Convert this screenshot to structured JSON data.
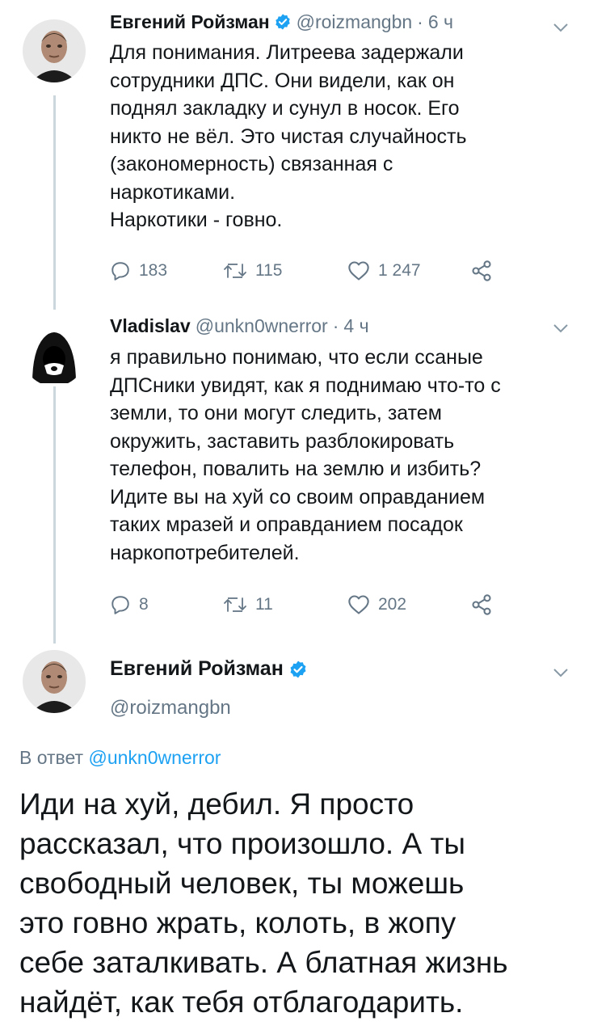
{
  "colors": {
    "text": "#14171a",
    "secondary": "#657786",
    "link": "#1da1f2",
    "verified": "#1da1f2",
    "thread_line": "#ccd6dd"
  },
  "tweet1": {
    "name": "Евгений Ройзман",
    "handle": "@roizmangbn",
    "time": "6 ч",
    "lines": [
      "Для понимания. Литреева задержали",
      "сотрудники ДПС. Они видели, как он",
      "поднял закладку и сунул в носок. Его",
      "никто не вёл. Это чистая случайность",
      "(закономерность) связанная с",
      "наркотиками.",
      "Наркотики - говно."
    ],
    "replies": "183",
    "retweets": "115",
    "likes": "1 247"
  },
  "tweet2": {
    "name": "Vladislav",
    "handle": "@unkn0wnerror",
    "time": "4 ч",
    "lines": [
      "я правильно понимаю, что если ссаные",
      "ДПСники увидят, как я поднимаю что-то с",
      "земли, то они могут следить, затем",
      "окружить, заставить разблокировать",
      "телефон, повалить на землю и избить?",
      "Идите вы на хуй со своим оправданием",
      "таких мразей и оправданием посадок",
      "наркопотребителей."
    ],
    "replies": "8",
    "retweets": "11",
    "likes": "202"
  },
  "tweet3": {
    "name": "Евгений Ройзман",
    "handle": "@roizmangbn",
    "reply_prefix": "В ответ",
    "reply_handle": "@unkn0wnerror",
    "lines": [
      "Иди на хуй, дебил. Я просто",
      "рассказал, что произошло. А ты",
      "свободный человек, ты можешь",
      "это говно жрать, колоть, в жопу",
      "себе заталкивать. А блатная жизнь",
      "найдёт, как тебя отблагодарить."
    ]
  },
  "icons": [
    "reply-icon",
    "retweet-icon",
    "like-icon",
    "share-icon",
    "verified-badge-icon",
    "chevron-down-icon"
  ]
}
